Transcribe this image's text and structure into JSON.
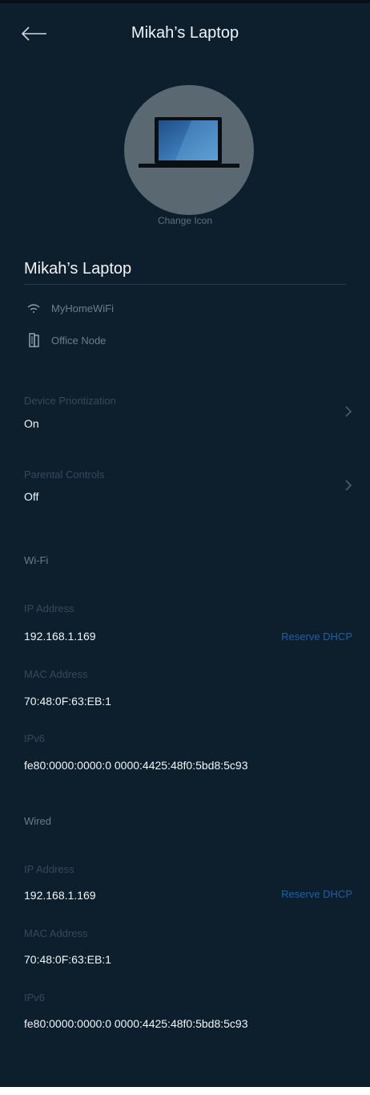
{
  "header": {
    "title": "Mikah’s Laptop"
  },
  "icon": {
    "name": "laptop-icon",
    "change_label": "Change Icon"
  },
  "device": {
    "name": "Mikah’s Laptop",
    "network": "MyHomeWiFi",
    "node": "Office Node"
  },
  "settings": {
    "prioritization": {
      "label": "Device Prioritization",
      "value": "On"
    },
    "parental": {
      "label": "Parental Controls",
      "value": "Off"
    }
  },
  "wifi": {
    "section": "Wi-Fi",
    "ip_label": "IP Address",
    "ip_value": "192.168.1.169",
    "reserve_label": "Reserve DHCP",
    "mac_label": "MAC Address",
    "mac_value": "70:48:0F:63:EB:1",
    "ipv6_label": "IPv6",
    "ipv6_value": "fe80:0000:0000:0 0000:4425:48f0:5bd8:5c93"
  },
  "wired": {
    "section": "Wired",
    "ip_label": "IP Address",
    "ip_value": "192.168.1.169",
    "reserve_label": "Reserve DHCP",
    "mac_label": "MAC Address",
    "mac_value": "70:48:0F:63:EB:1",
    "ipv6_label": "IPv6",
    "ipv6_value": "fe80:0000:0000:0 0000:4425:48f0:5bd8:5c93"
  },
  "colors": {
    "background": "#0d1f2d",
    "link": "#1e5fa6",
    "muted_text": "#6d7e89",
    "dim_label": "#34495a"
  }
}
